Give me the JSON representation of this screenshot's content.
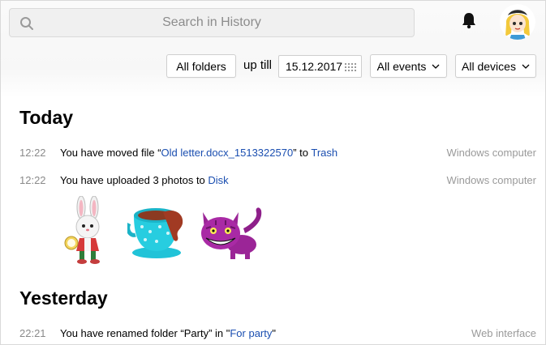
{
  "search": {
    "placeholder": "Search in History"
  },
  "filters": {
    "folders_label": "All folders",
    "up_till_label": "up till",
    "date_value": "15.12.2017",
    "events_label": "All events",
    "devices_label": "All devices"
  },
  "sections": {
    "today": "Today",
    "yesterday": "Yesterday"
  },
  "events": [
    {
      "time": "12:22",
      "prefix": "You have moved file “",
      "link1": "Old letter.docx_1513322570",
      "middle": "” to ",
      "link2": "Trash",
      "device": "Windows computer"
    },
    {
      "time": "12:22",
      "prefix": "You have uploaded 3 photos to ",
      "link1": "Disk",
      "device": "Windows computer"
    },
    {
      "time": "22:21",
      "prefix": "You have renamed folder “Party” in \"",
      "link1": "For party",
      "suffix": "\"",
      "device": "Web interface"
    }
  ],
  "photos": [
    "rabbit-sticker",
    "teacup-sticker",
    "cheshire-cat-sticker"
  ],
  "colors": {
    "link": "#1a4eb0",
    "muted": "#8a8a8a"
  }
}
